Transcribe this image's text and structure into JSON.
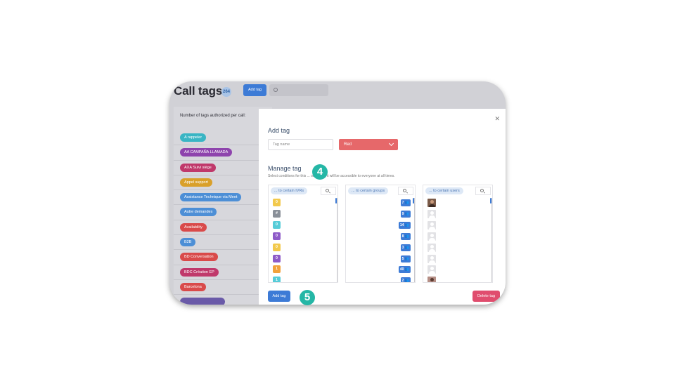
{
  "app": {
    "title": "Call tags",
    "count": "264",
    "add_tag_label": "Add tag",
    "tags_per_call_label": "Number of tags authorized per call:",
    "tags": [
      {
        "label": "A rappeler",
        "color": "#39b5c4"
      },
      {
        "label": "AA CAMPAÑA LLAMADA",
        "color": "#8e44ad"
      },
      {
        "label": "AXA Suivi siège",
        "color": "#c0396b"
      },
      {
        "label": "Appel support",
        "color": "#d9a02a"
      },
      {
        "label": "Assistance Technique via Meet",
        "color": "#4d8fd6"
      },
      {
        "label": "Autre demandes",
        "color": "#4d8fd6"
      },
      {
        "label": "Availability",
        "color": "#d94a4a"
      },
      {
        "label": "B2B",
        "color": "#4d8fd6"
      },
      {
        "label": "BD Conversation",
        "color": "#d94a4a"
      },
      {
        "label": "BDC Création EP",
        "color": "#c0396b"
      },
      {
        "label": "Barcelona",
        "color": "#d94a4a"
      },
      {
        "label": "",
        "color": "#6a5aa8"
      }
    ]
  },
  "modal": {
    "title": "Add tag",
    "close_icon": "close-icon",
    "tag_name_placeholder": "Tag name",
    "color_value": "Red",
    "manage_title": "Manage tag",
    "manage_desc": "Select conditions for this ... otherwise it will be accessible to everyone at all times.",
    "columns": {
      "ivrs": {
        "label": "... to certain IVRs",
        "items": [
          {
            "value": "0",
            "color": "#f2c94c"
          },
          {
            "value": "#",
            "color": "#8a9099"
          },
          {
            "value": "0",
            "color": "#56ccd8"
          },
          {
            "value": "0",
            "color": "#8e5bc8"
          },
          {
            "value": "0",
            "color": "#f2c94c"
          },
          {
            "value": "0",
            "color": "#8e5bc8"
          },
          {
            "value": "1",
            "color": "#f2a23c"
          },
          {
            "value": "1",
            "color": "#56ccd8"
          }
        ]
      },
      "groups": {
        "label": "... to certain groups",
        "items": [
          "7",
          "9",
          "14",
          "8",
          "3",
          "5",
          "40",
          "2"
        ]
      },
      "users": {
        "label": "... to certain users",
        "avatars": [
          "photo",
          "placeholder",
          "placeholder",
          "placeholder",
          "placeholder",
          "placeholder",
          "placeholder",
          "photo2"
        ]
      }
    },
    "add_tag_button": "Add tag",
    "delete_tag_button": "Delete tag"
  },
  "step_badges": [
    "4",
    "5"
  ]
}
